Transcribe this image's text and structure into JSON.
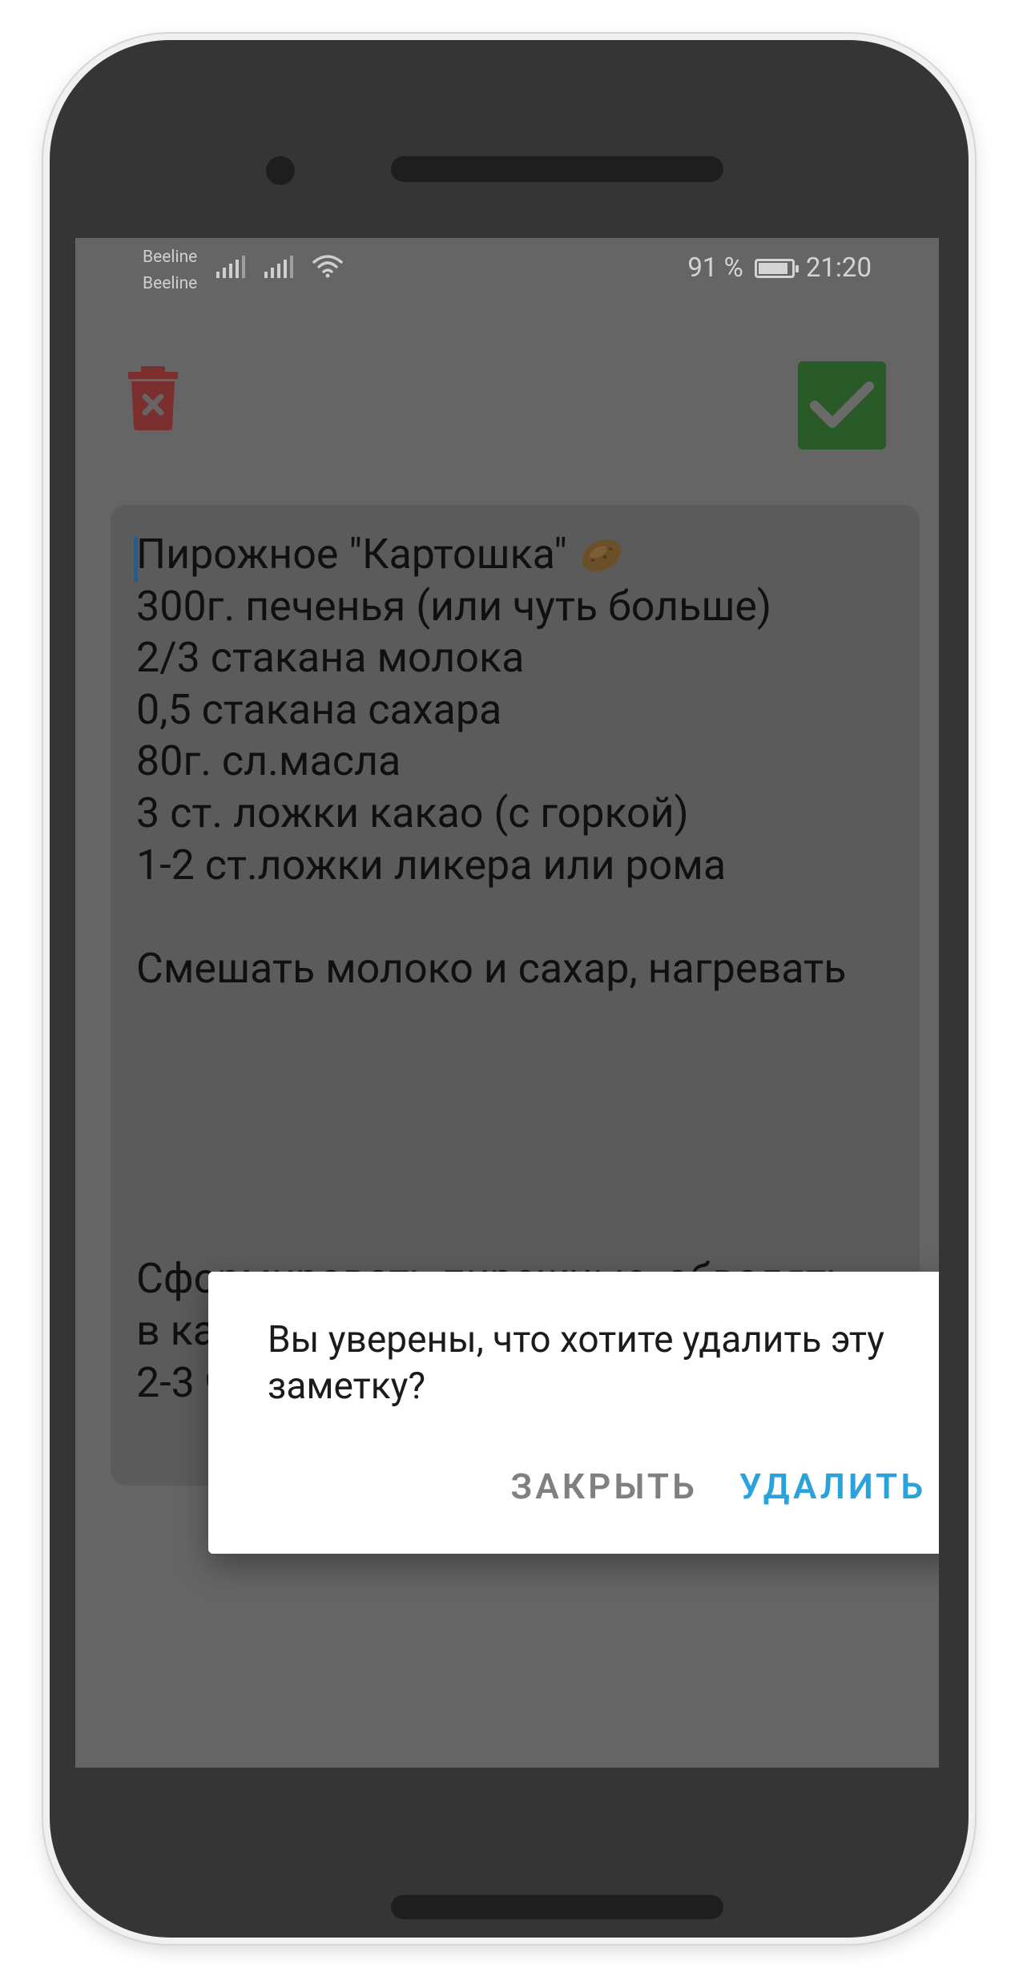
{
  "status_bar": {
    "carrier_1": "Beeline",
    "carrier_2": "Beeline",
    "battery": "91 %",
    "battery_level": 0.91,
    "time": "21:20"
  },
  "toolbar": {
    "delete_icon": "trash-icon",
    "delete_icon_color": "#7a2e2e",
    "save_icon": "check-icon",
    "save_button_color": "#2a5a27"
  },
  "note": {
    "title": "Пирожное \"Картошка\"",
    "title_emoji": "potato-emoji",
    "body": "\n300г. печенья (или чуть больше)\n2/3 стакана молока\n0,5 стакана сахара\n80г. сл.масла\n3 ст. ложки какао (с горкой)\n1-2 ст.ложки ликера или рома\n\nСмешать молоко и сахар, нагревать\n\n\n\n\n\nСформировать пирожные, обвалять\nв какао, убрать в холодильник на\n2-3 часа."
  },
  "dialog": {
    "message": "Вы уверены, что хотите удалить эту заметку?",
    "close_label": "ЗАКРЫТЬ",
    "delete_label": "УДАЛИТЬ",
    "accent_color": "#2aa3dd"
  }
}
